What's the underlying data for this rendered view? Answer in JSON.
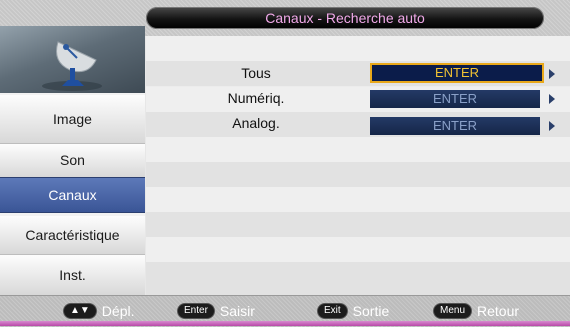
{
  "header": {
    "title": "Canaux - Recherche auto"
  },
  "sidebar": {
    "icon": "satellite-dish-icon",
    "items": [
      {
        "label": "Image"
      },
      {
        "label": "Son"
      },
      {
        "label": "Canaux",
        "active": true
      },
      {
        "label": "Caractéristique"
      },
      {
        "label": "Inst."
      }
    ]
  },
  "content": {
    "options": [
      {
        "label": "Tous",
        "value": "ENTER",
        "focused": true
      },
      {
        "label": "Numériq.",
        "value": "ENTER"
      },
      {
        "label": "Analog.",
        "value": "ENTER"
      }
    ]
  },
  "footer": {
    "hints": [
      {
        "key": "▲▼",
        "label": "Dépl."
      },
      {
        "key": "Enter",
        "label": "Saisir"
      },
      {
        "key": "Exit",
        "label": "Sortie"
      },
      {
        "key": "Menu",
        "label": "Retour"
      }
    ]
  },
  "colors": {
    "accent_focus": "#e9a81a",
    "title_text": "#f0a8e8",
    "active_menu": "#4b66a8"
  }
}
